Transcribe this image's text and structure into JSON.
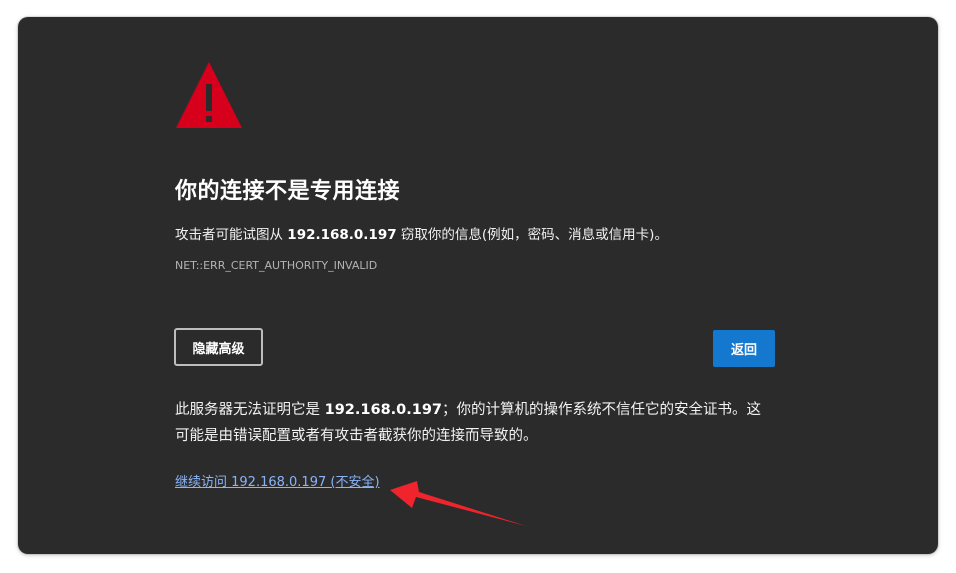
{
  "page": {
    "title": "你的连接不是专用连接",
    "description_prefix": "攻击者可能试图从 ",
    "host": "192.168.0.197",
    "description_suffix": " 窃取你的信息(例如，密码、消息或信用卡)。",
    "error_code": "NET::ERR_CERT_AUTHORITY_INVALID",
    "hide_advanced_label": "隐藏高级",
    "back_label": "返回",
    "details_prefix": "此服务器无法证明它是 ",
    "details_suffix": "；你的计算机的操作系统不信任它的安全证书。这可能是由错误配置或者有攻击者截获你的连接而导致的。",
    "proceed_link": "继续访问 192.168.0.197 (不安全)"
  },
  "icons": {
    "warning": "warning-triangle-icon",
    "annotation": "red-arrow-annotation"
  },
  "colors": {
    "background": "#2b2b2b",
    "warning": "#d6001c",
    "primary_button": "#1478cf",
    "link": "#8ab4f8",
    "annotation": "#f0242c"
  }
}
